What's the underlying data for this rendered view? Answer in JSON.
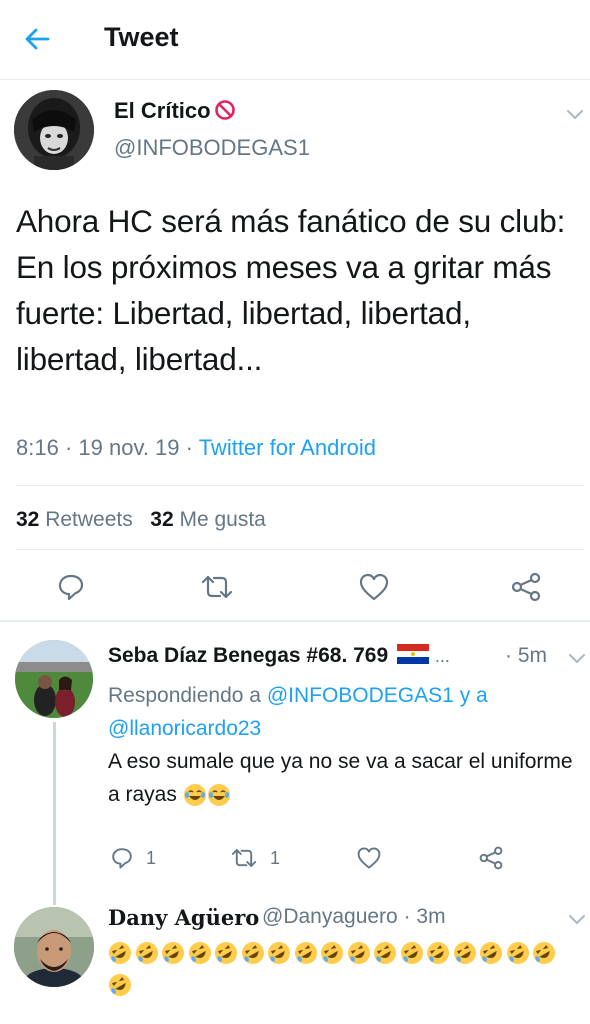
{
  "header": {
    "title": "Tweet"
  },
  "main_tweet": {
    "display_name": "El Crítico",
    "handle": "@INFOBODEGAS1",
    "text": "Ahora HC será más fanático de su club: En los próximos meses va a gritar más fuerte: Libertad, libertad, libertad, libertad, libertad...",
    "time": "8:16",
    "date": "19 nov. 19",
    "source": "Twitter for Android",
    "retweets_count": "32",
    "retweets_label": "Retweets",
    "likes_count": "32",
    "likes_label": "Me gusta"
  },
  "reply1": {
    "display_name": "Seba Díaz Benegas #68. 769",
    "ellipsis": "...",
    "time": "5m",
    "replying_prefix": "Respondiendo a",
    "replying_user1": "@INFOBODEGAS1",
    "replying_and": "y a",
    "replying_user2": "@llanoricardo23",
    "text": "A eso sumale que ya no se va a sacar el uniforme a rayas",
    "reply_count": "1",
    "retweet_count": "1"
  },
  "reply2": {
    "display_name": "Dany Agüero",
    "handle": "@Danyaguero",
    "time": "3m",
    "emoji_count": 18
  },
  "colors": {
    "accent": "#1da1f2",
    "secondary_text": "#657786",
    "primary_text": "#14171a",
    "divider": "#e6ecf0"
  },
  "icons": [
    "back-arrow-icon",
    "chevron-down-icon",
    "reply-icon",
    "retweet-icon",
    "like-icon",
    "share-icon",
    "no-entry-icon",
    "paraguay-flag-icon",
    "joy-emoji-icon",
    "rofl-emoji-icon"
  ]
}
